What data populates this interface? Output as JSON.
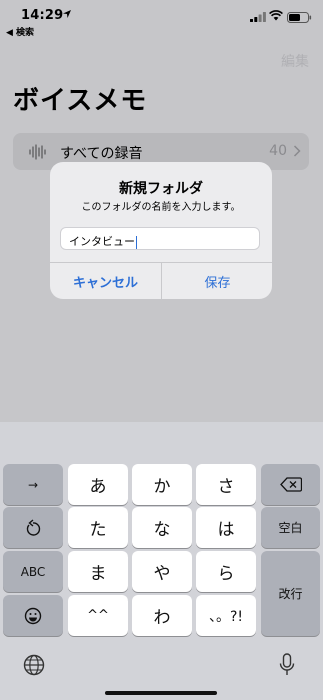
{
  "status_bar": {
    "time": "14:29",
    "back_label": "◀ 検索"
  },
  "app": {
    "edit_label": "編集",
    "title": "ボイスメモ",
    "all_recordings": {
      "label": "すべての録音",
      "count": "40"
    }
  },
  "dialog": {
    "title": "新規フォルダ",
    "message": "このフォルダの名前を入力します。",
    "input_value": "インタビュー",
    "cancel_label": "キャンセル",
    "save_label": "保存"
  },
  "keyboard": {
    "row1": [
      "→",
      "あ",
      "か",
      "さ"
    ],
    "row2": [
      "た",
      "な",
      "は"
    ],
    "row2_right": "空白",
    "row3_left": "ABC",
    "row3": [
      "ま",
      "や",
      "ら"
    ],
    "row3_right": "改行",
    "row4": [
      "^^",
      "わ",
      "、。?!"
    ],
    "icons": [
      "delete-icon",
      "undo-icon",
      "emoji-icon",
      "globe-icon",
      "mic-icon"
    ]
  },
  "colors": {
    "accent": "#2d6fd6"
  }
}
